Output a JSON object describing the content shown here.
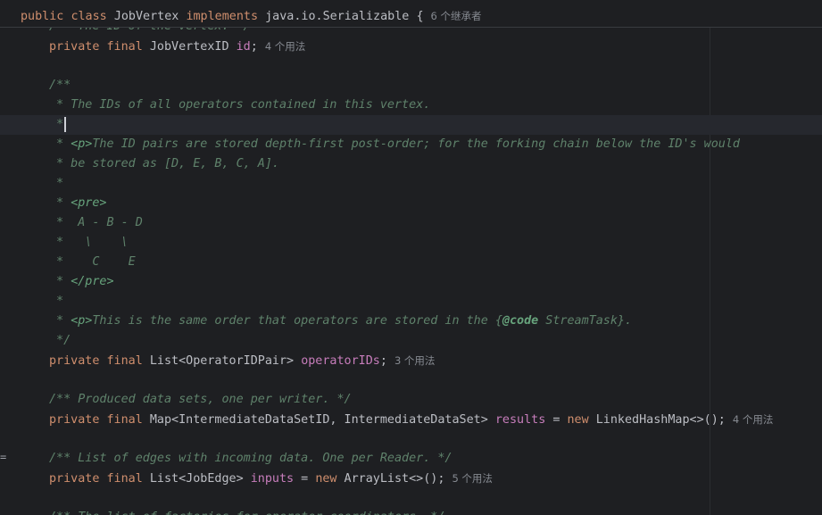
{
  "editor": {
    "sticky_header": {
      "kw_public": "public",
      "kw_class": "class",
      "class_name": "JobVertex",
      "kw_implements": "implements",
      "interface": "java.io.Serializable",
      "brace": "{",
      "hint": "6 个继承者"
    },
    "lines": {
      "l0_doc": "/** The ID of the vertex. */",
      "l1_kw1": "private",
      "l1_kw2": "final",
      "l1_type": "JobVertexID",
      "l1_field": "id",
      "l1_semi": ";",
      "l1_hint": "4 个用法",
      "l3": "/**",
      "l4": " * The IDs of all operators contained in this vertex.",
      "l5": " *",
      "l6_a": " * ",
      "l6_tag": "<p>",
      "l6_b": "The ID pairs are stored depth-first post-order; for the forking chain below the ID's would",
      "l7": " * be stored as [D, E, B, C, A].",
      "l8": " *",
      "l9_a": " * ",
      "l9_tag": "<pre>",
      "l10": " *  A - B - D",
      "l11": " *   \\    \\",
      "l12": " *    C    E",
      "l13_a": " * ",
      "l13_tag": "</pre>",
      "l14": " *",
      "l15_a": " * ",
      "l15_tag": "<p>",
      "l15_b": "This is the same order that operators are stored in the {",
      "l15_code": "@code",
      "l15_c": " StreamTask}.",
      "l16": " */",
      "l17_kw1": "private",
      "l17_kw2": "final",
      "l17_type": "List<OperatorIDPair>",
      "l17_field": "operatorIDs",
      "l17_semi": ";",
      "l17_hint": "3 个用法",
      "l19": "/** Produced data sets, one per writer. */",
      "l20_kw1": "private",
      "l20_kw2": "final",
      "l20_type": "Map<IntermediateDataSetID, IntermediateDataSet>",
      "l20_field": "results",
      "l20_eq": " = ",
      "l20_new": "new",
      "l20_ctor": " LinkedHashMap<>();",
      "l20_hint": "4 个用法",
      "l22": "/** List of edges with incoming data. One per Reader. */",
      "l23_kw1": "private",
      "l23_kw2": "final",
      "l23_type": "List<JobEdge>",
      "l23_field": "inputs",
      "l23_eq": " = ",
      "l23_new": "new",
      "l23_ctor": " ArrayList<>();",
      "l23_hint": "5 个用法",
      "l25": "/** The list of factories for operator coordinators. */"
    },
    "gutter_mark": "="
  }
}
